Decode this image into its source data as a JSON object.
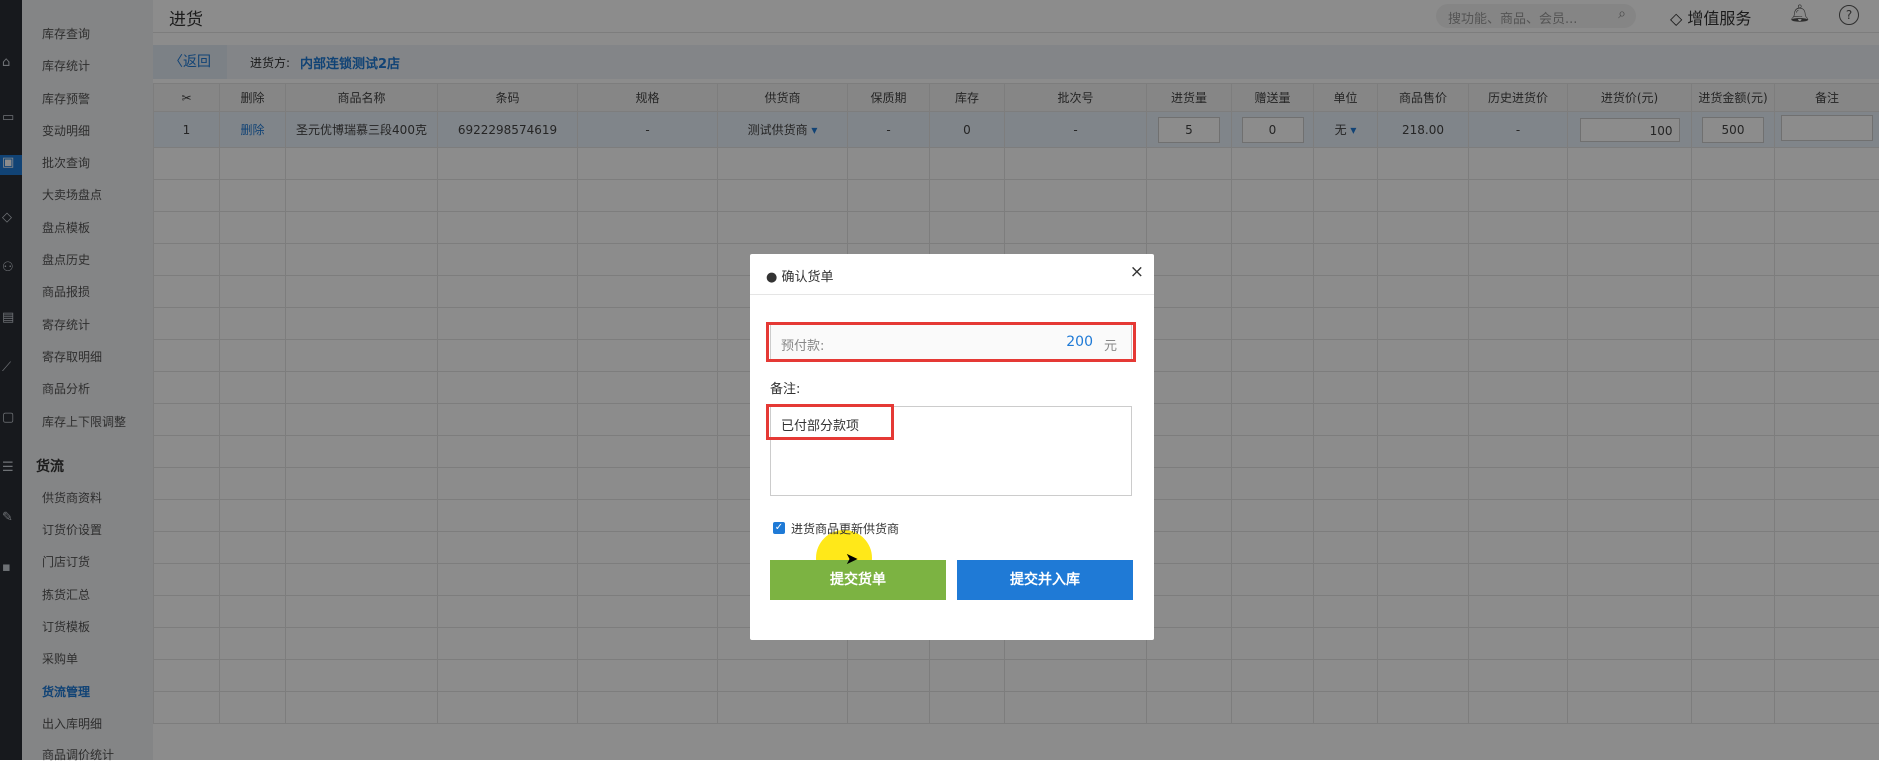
{
  "topbar": {
    "title": "进货",
    "search_placeholder": "搜功能、商品、会员...",
    "value_added_label": "增值服务"
  },
  "sidebar": {
    "items": [
      "库存查询",
      "库存统计",
      "库存预警",
      "变动明细",
      "批次查询",
      "大卖场盘点",
      "盘点模板",
      "盘点历史",
      "商品报损",
      "寄存统计",
      "寄存取明细",
      "商品分析",
      "库存上下限调整"
    ],
    "section_label": "货流",
    "items2": [
      "供货商资料",
      "订货价设置",
      "门店订货",
      "拣货汇总",
      "订货模板",
      "采购单",
      "货流管理",
      "出入库明细",
      "商品调价统计"
    ],
    "active_index2": 6
  },
  "subbar": {
    "back_label": "返回",
    "supplier_label": "进货方:",
    "supplier_value": "内部连锁测试2店"
  },
  "table": {
    "headers": [
      "",
      "删除",
      "商品名称",
      "条码",
      "规格",
      "供货商",
      "保质期",
      "库存",
      "批次号",
      "进货量",
      "赠送量",
      "单位",
      "商品售价",
      "历史进货价",
      "进货价(元)",
      "进货金额(元)",
      "备注"
    ],
    "row": {
      "index": "1",
      "delete": "删除",
      "name": "圣元优博瑞慕三段400克",
      "barcode": "6922298574619",
      "spec": "-",
      "supplier": "测试供货商",
      "shelf_life": "-",
      "stock": "0",
      "batch": "-",
      "qty": "5",
      "gift": "0",
      "unit": "无",
      "price": "218.00",
      "history_price": "-",
      "purchase_price": "100",
      "amount": "500"
    }
  },
  "modal": {
    "title": "确认货单",
    "close": "×",
    "prepay_label": "预付款:",
    "prepay_value": "200",
    "prepay_unit": "元",
    "remark_label": "备注:",
    "remark_value": "已付部分款项",
    "checkbox_label": "进货商品更新供货商",
    "checkbox_checked": true,
    "submit_label": "提交货单",
    "submit_stock_label": "提交并入库"
  }
}
